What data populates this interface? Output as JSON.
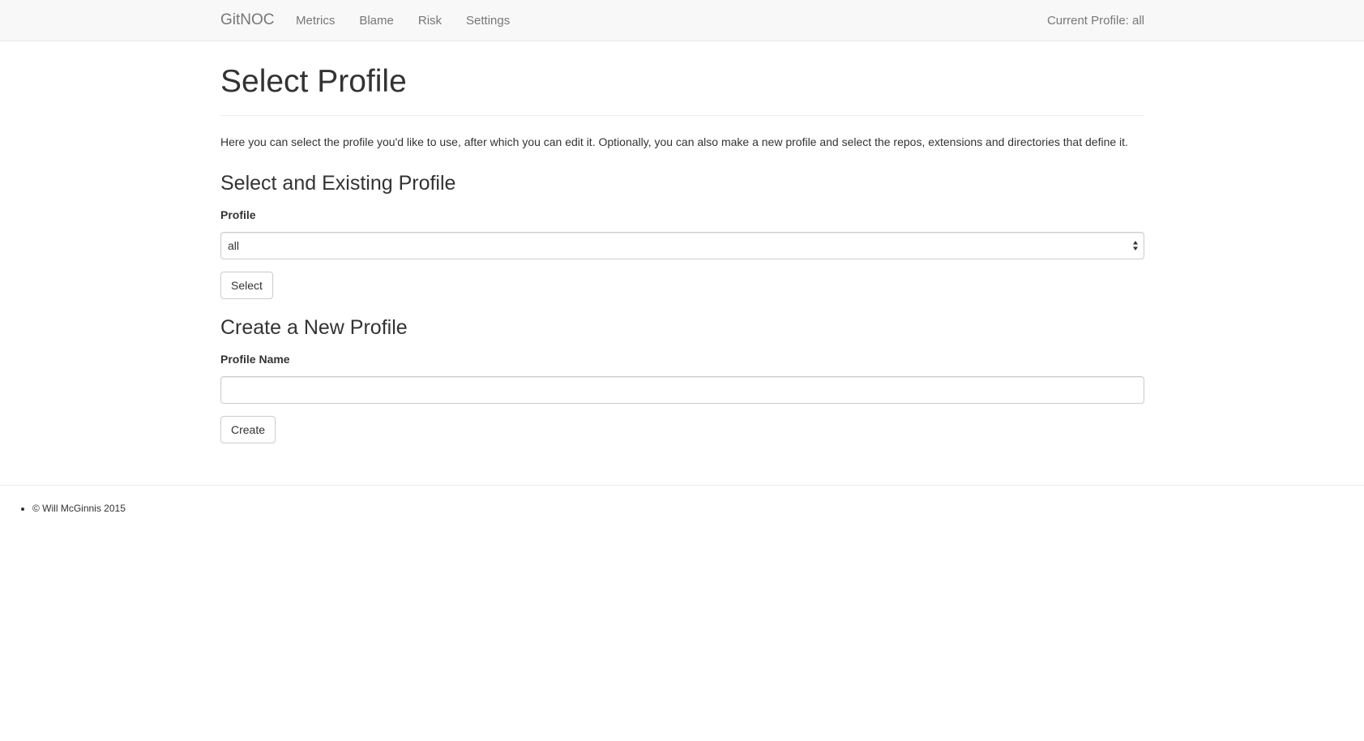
{
  "navbar": {
    "brand": "GitNOC",
    "links": [
      "Metrics",
      "Blame",
      "Risk",
      "Settings"
    ],
    "current_profile": "Current Profile: all"
  },
  "main": {
    "title": "Select Profile",
    "intro": "Here you can select the profile you'd like to use, after which you can edit it. Optionally, you can also make a new profile and select the repos, extensions and directories that define it.",
    "select_section": {
      "heading": "Select and Existing Profile",
      "label": "Profile",
      "selected_value": "all",
      "button_label": "Select"
    },
    "create_section": {
      "heading": "Create a New Profile",
      "label": "Profile Name",
      "input_value": "",
      "button_label": "Create"
    }
  },
  "footer": {
    "copyright": "© Will McGinnis 2015"
  }
}
